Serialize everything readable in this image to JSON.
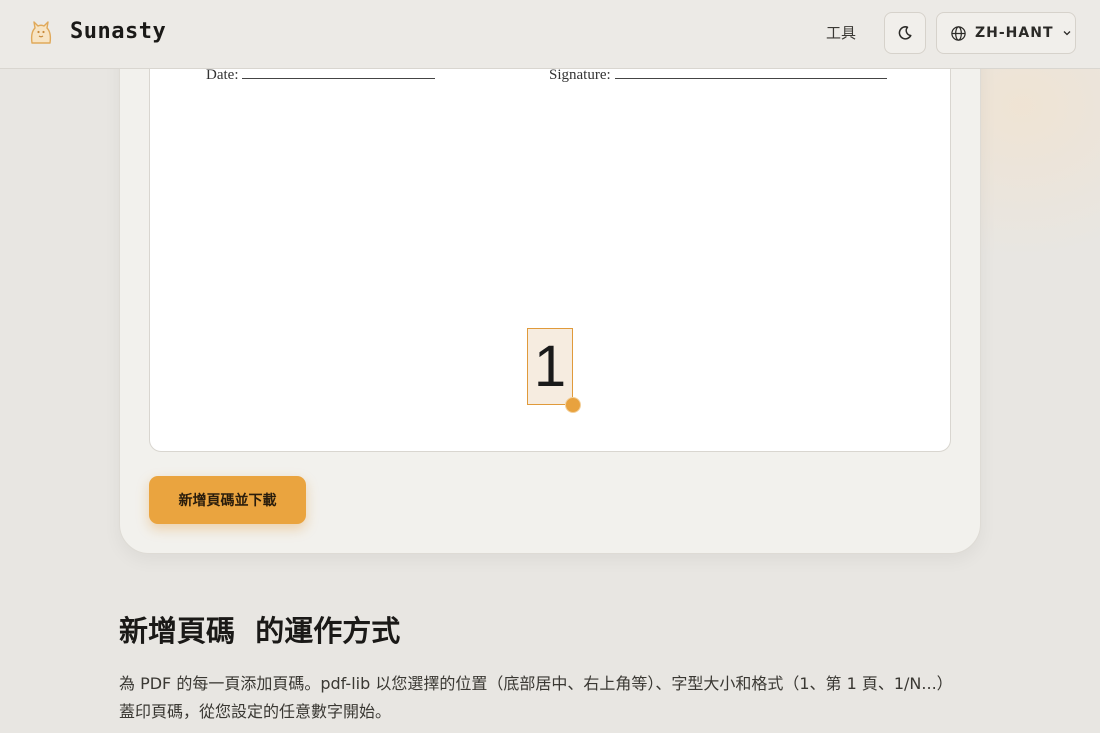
{
  "header": {
    "brand": "Sunasty",
    "nav_tools": "工具",
    "theme_icon": "moon-icon",
    "language": "ZH-HANT",
    "language_icon": "globe-icon",
    "dropdown_icon": "chevron-down-icon"
  },
  "preview": {
    "date_label": "Date:",
    "signature_label": "Signature:",
    "page_number": "1"
  },
  "actions": {
    "add_and_download": "新增頁碼並下載"
  },
  "section": {
    "title": "新增頁碼  的運作方式",
    "description_line1": "為 PDF 的每一頁添加頁碼。pdf-lib 以您選擇的位置（底部居中、右上角等）、字型大小和格式（1、第 1 頁、1/N...）",
    "description_line2": "蓋印頁碼，從您設定的任意數字開始。"
  },
  "colors": {
    "accent": "#eaa43f",
    "background": "#e8e6e2",
    "card": "#f2f1ed"
  }
}
